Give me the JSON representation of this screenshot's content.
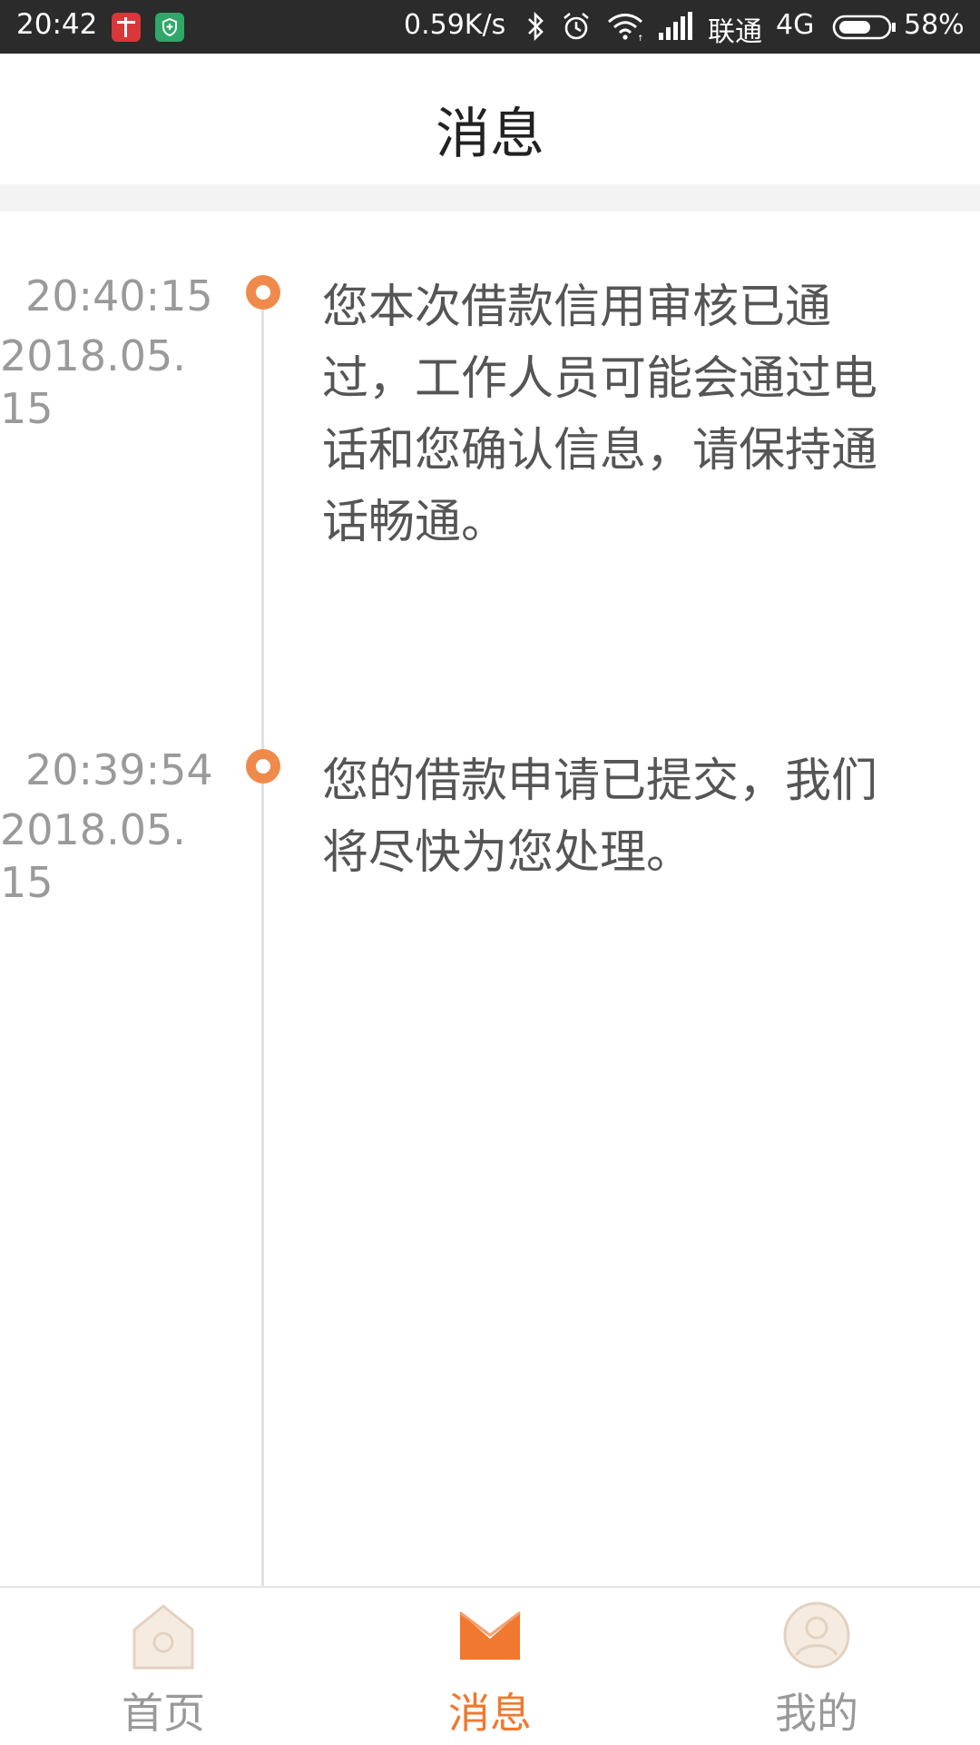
{
  "status_bar": {
    "time": "20:42",
    "network_speed": "0.59K/s",
    "carrier": "联通",
    "network_type": "4G",
    "battery_percent": "58%"
  },
  "header": {
    "title": "消息"
  },
  "timeline": {
    "entries": [
      {
        "time": "20:40:15",
        "date": "2018.05.15",
        "message": "您本次借款信用审核已通过，工作人员可能会通过电话和您确认信息，请保持通话畅通。"
      },
      {
        "time": "20:39:54",
        "date": "2018.05.15",
        "message": "您的借款申请已提交，我们将尽快为您处理。"
      }
    ]
  },
  "bottom_nav": {
    "items": [
      {
        "label": "首页",
        "icon": "home-icon",
        "active": false
      },
      {
        "label": "消息",
        "icon": "envelope-icon",
        "active": true
      },
      {
        "label": "我的",
        "icon": "profile-icon",
        "active": false
      }
    ],
    "active_color": "#f0782f",
    "inactive_color": "#999999"
  },
  "colors": {
    "accent": "#f08a4b",
    "status_bar_bg": "#2b2b2b"
  }
}
